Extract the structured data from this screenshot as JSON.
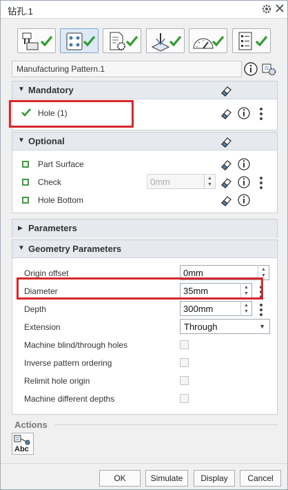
{
  "window": {
    "title": "钻孔.1",
    "icons": [
      "gear-icon",
      "close-icon"
    ]
  },
  "toolbar": {
    "tabs": [
      {
        "name": "geometry-tab",
        "icon": "drill-tool-icon",
        "checked": true,
        "active": false
      },
      {
        "name": "tool-tab",
        "icon": "pattern-grid-icon",
        "checked": true,
        "active": true
      },
      {
        "name": "parameters-tab",
        "icon": "document-gear-icon",
        "checked": true,
        "active": false
      },
      {
        "name": "strategy-tab",
        "icon": "approach-macro-icon",
        "checked": true,
        "active": false
      },
      {
        "name": "feeds-speeds-tab",
        "icon": "speedometer-icon",
        "checked": true,
        "active": false
      },
      {
        "name": "checklist-tab",
        "icon": "checklist-icon",
        "checked": true,
        "active": false
      }
    ]
  },
  "operation_name": "Manufacturing Pattern.1",
  "mandatory": {
    "title": "Mandatory",
    "items": [
      {
        "label": "Hole (1)",
        "status": "complete"
      }
    ]
  },
  "optional": {
    "title": "Optional",
    "items": [
      {
        "label": "Part Surface"
      },
      {
        "label": "Check",
        "value": "0mm"
      },
      {
        "label": "Hole Bottom"
      }
    ]
  },
  "parameters": {
    "title": "Parameters",
    "expanded": false
  },
  "geometry": {
    "title": "Geometry Parameters",
    "origin_offset": {
      "label": "Origin offset",
      "value": "0mm"
    },
    "diameter": {
      "label": "Diameter",
      "value": "35mm"
    },
    "depth": {
      "label": "Depth",
      "value": "300mm"
    },
    "extension": {
      "label": "Extension",
      "value": "Through"
    },
    "machine_blind_through": {
      "label": "Machine blind/through holes",
      "checked": false
    },
    "inverse_pattern": {
      "label": "Inverse pattern ordering",
      "checked": false
    },
    "relimit_origin": {
      "label": "Relimit hole origin",
      "checked": false
    },
    "machine_diff_depths": {
      "label": "Machine different depths",
      "checked": false
    }
  },
  "actions": {
    "label": "Actions",
    "button_text": "Abc"
  },
  "footer": {
    "ok": "OK",
    "simulate": "Simulate",
    "display": "Display",
    "cancel": "Cancel"
  },
  "colors": {
    "check_green": "#2e9b2e",
    "highlight_red": "#d8262c",
    "active_tab": "#dde9f6"
  }
}
